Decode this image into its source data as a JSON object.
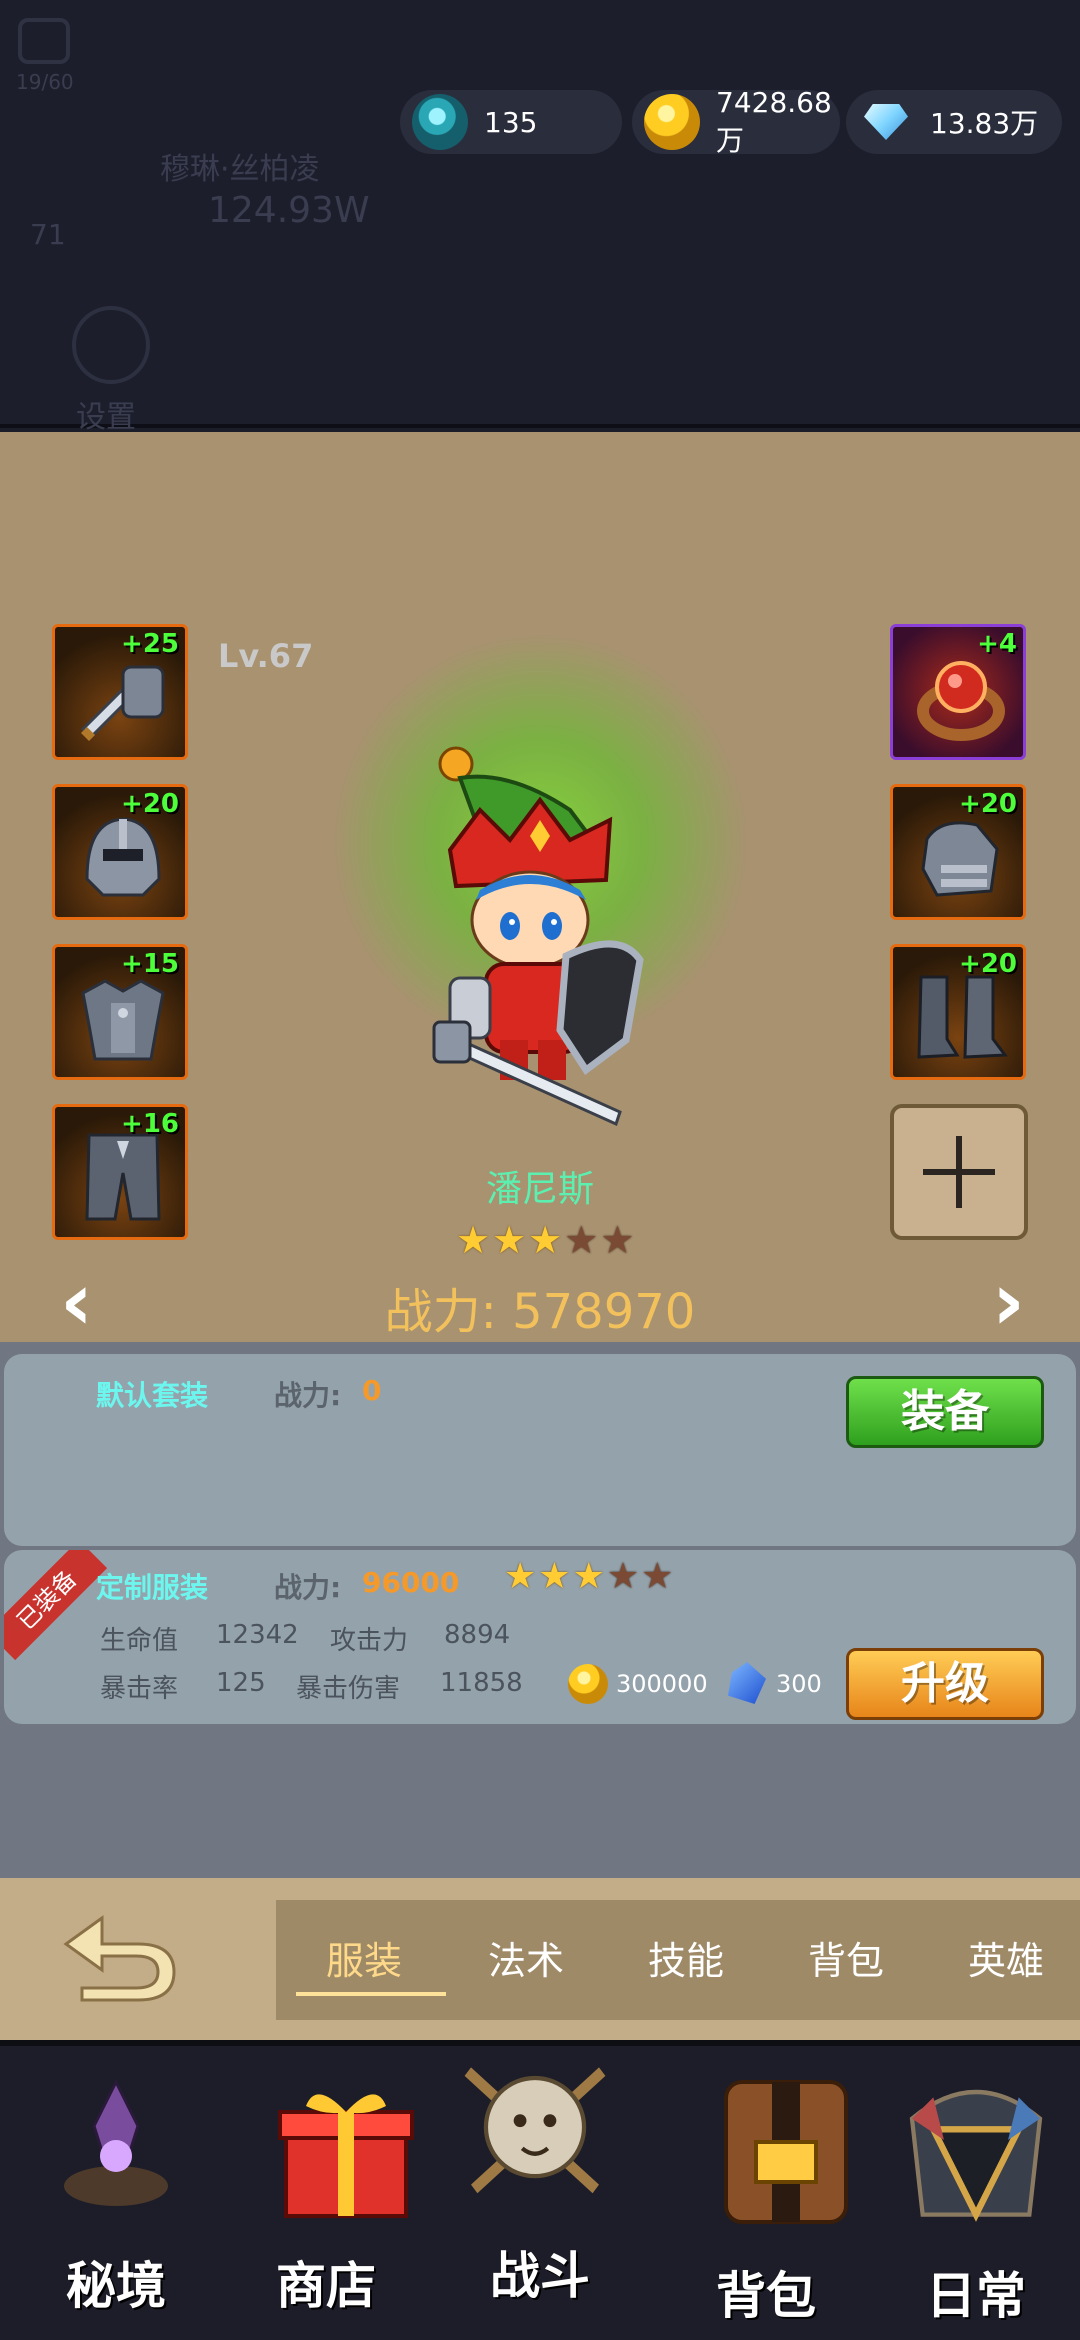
{
  "top_overlay": {
    "stamina": "19/60",
    "player_name": "穆琳·丝柏凌",
    "player_power": "124.93W",
    "player_level": "71",
    "settings_label": "设置"
  },
  "resources": {
    "soul": "135",
    "gold": "7428.68万",
    "diamond": "13.83万"
  },
  "hero": {
    "level": "Lv.67",
    "name": "潘尼斯",
    "stars_total": 5,
    "stars_filled": 3,
    "power_label": "战力: 578970",
    "left_equipment": [
      {
        "name": "weapon",
        "bonus": "+25",
        "icon": "sword-icon"
      },
      {
        "name": "helmet",
        "bonus": "+20",
        "icon": "helmet-icon"
      },
      {
        "name": "chest-armor",
        "bonus": "+15",
        "icon": "armor-icon"
      },
      {
        "name": "leggings",
        "bonus": "+16",
        "icon": "leggings-icon"
      }
    ],
    "right_equipment": [
      {
        "name": "ring",
        "bonus": "+4",
        "icon": "ring-icon"
      },
      {
        "name": "gauntlets",
        "bonus": "+20",
        "icon": "gauntlet-icon"
      },
      {
        "name": "boots",
        "bonus": "+20",
        "icon": "boots-icon"
      }
    ]
  },
  "outfits": {
    "default": {
      "title": "默认套装",
      "power_label": "战力:",
      "power_value": "0",
      "button": "装备"
    },
    "custom": {
      "ribbon": "已装备",
      "title": "定制服装",
      "power_label": "战力:",
      "power_value": "96000",
      "stars_total": 5,
      "stars_filled": 3,
      "hp_label": "生命值",
      "hp_value": "12342",
      "atk_label": "攻击力",
      "atk_value": "8894",
      "crit_label": "暴击率",
      "crit_value": "125",
      "critdmg_label": "暴击伤害",
      "critdmg_value": "11858",
      "gold_cost": "300000",
      "crystal_cost": "300",
      "button": "升级"
    }
  },
  "tabs": [
    "服装",
    "法术",
    "技能",
    "背包",
    "英雄"
  ],
  "active_tab": "服装",
  "nav": [
    "秘境",
    "商店",
    "战斗",
    "背包",
    "日常"
  ],
  "colors": {
    "stage_bg": "#a89270",
    "panel_bg": "#707782",
    "card_bg": "#94a2ab",
    "power_gold": "#f3c15c",
    "name_teal": "#5cf0b0"
  }
}
